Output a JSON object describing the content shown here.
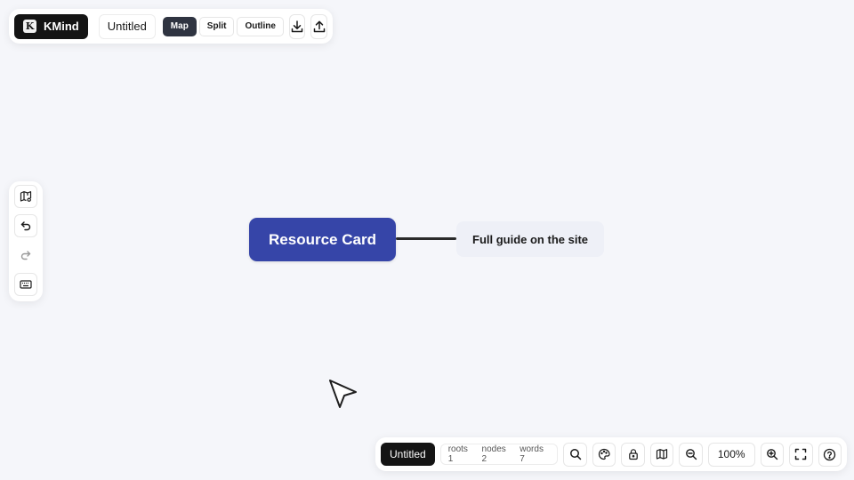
{
  "app": {
    "brand_letter": "K",
    "brand_name": "KMind",
    "doc_title": "Untitled"
  },
  "view_modes": [
    {
      "label": "Map",
      "active": true
    },
    {
      "label": "Split",
      "active": false
    },
    {
      "label": "Outline",
      "active": false
    }
  ],
  "top_actions": {
    "download_icon": "download-icon",
    "upload_icon": "upload-icon"
  },
  "left_toolbar": {
    "items": [
      "map-settings-icon",
      "undo-icon",
      "redo-icon",
      "keyboard-icon"
    ],
    "redo_disabled": true
  },
  "mindmap": {
    "root_label": "Resource Card",
    "child_label": "Full guide on the site",
    "root_color": "#3645a8"
  },
  "status": {
    "title": "Untitled",
    "roots": "roots 1",
    "nodes": "nodes 2",
    "words": "words 7",
    "zoom": "100%"
  },
  "bottom_actions": [
    "search-icon",
    "theme-icon",
    "lock-icon",
    "map-icon",
    "zoom-out-icon",
    "zoom-in-icon",
    "fullscreen-icon",
    "help-icon"
  ]
}
